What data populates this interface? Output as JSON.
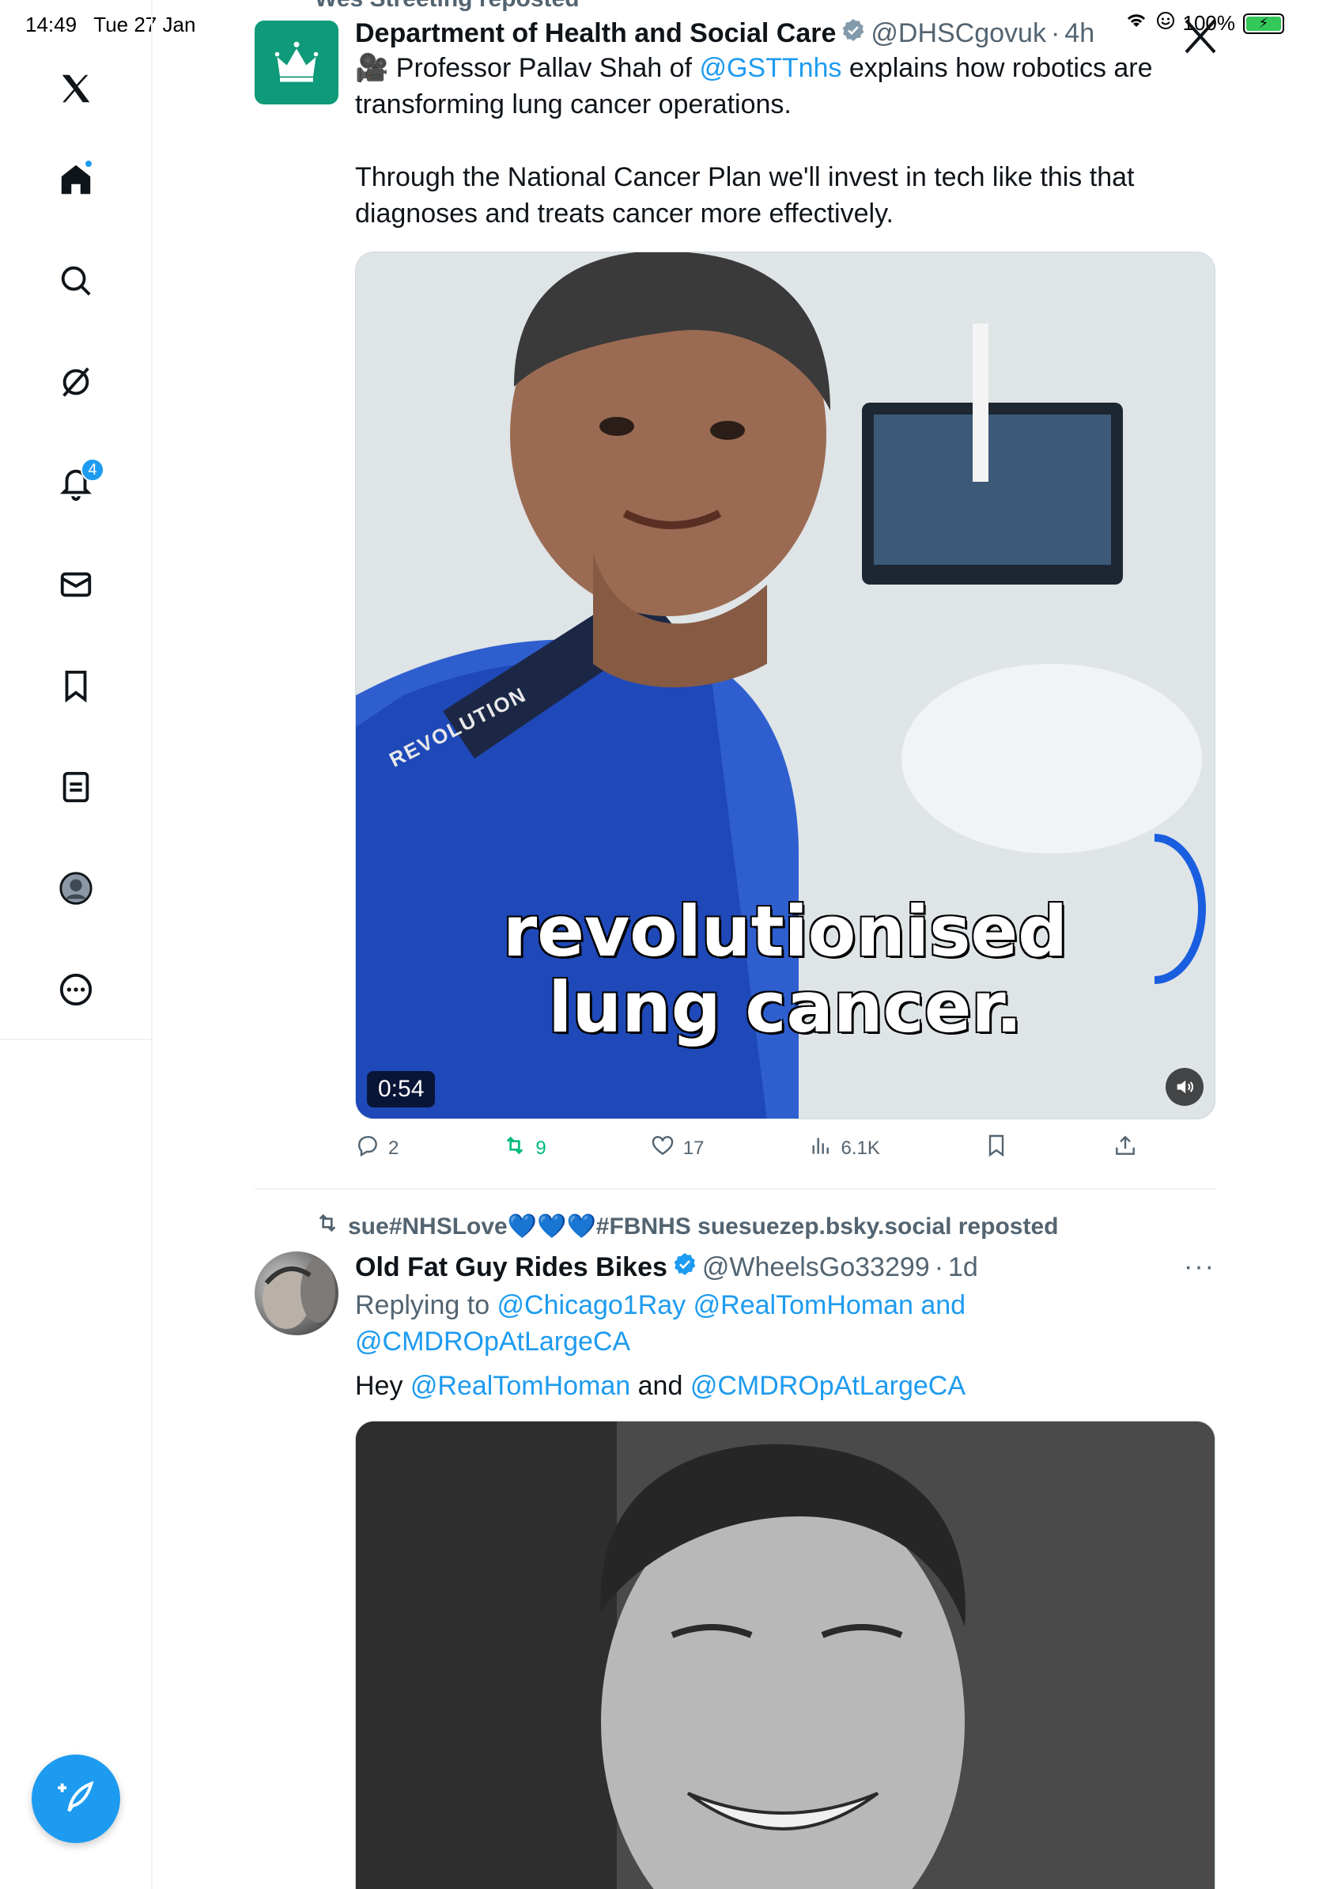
{
  "status": {
    "time": "14:49",
    "date": "Tue 27 Jan",
    "battery": "100%",
    "battery_color": "#34c759"
  },
  "sidebar": {
    "items": [
      {
        "icon": "x-logo-icon"
      },
      {
        "icon": "home-icon",
        "has_dot": true
      },
      {
        "icon": "search-icon"
      },
      {
        "icon": "grok-icon"
      },
      {
        "icon": "bell-icon",
        "badge": "4"
      },
      {
        "icon": "mail-icon"
      },
      {
        "icon": "bookmark-icon"
      },
      {
        "icon": "lists-icon"
      },
      {
        "icon": "profile-icon"
      },
      {
        "icon": "more-circle-icon"
      }
    ],
    "compose_icon": "compose-icon",
    "accent": "#1d9bf0"
  },
  "tweet1": {
    "reposted_by": "Wes Streeting reposted",
    "name": "Department of Health and Social Care",
    "handle": "@DHSCgovuk",
    "time": "4h",
    "text_emoji": "🎥",
    "text_part1": " Professor Pallav Shah of ",
    "text_mention": "@GSTTnhs",
    "text_part2": " explains how robotics are transforming lung cancer operations.",
    "text_para2": "Through the National Cancer Plan we'll invest in tech like this that diagnoses and treats cancer more effectively.",
    "video": {
      "caption_line1": "revolutionised",
      "caption_line2": "lung cancer.",
      "vest_text": "REVOLUTION",
      "duration": "0:54"
    },
    "actions": {
      "replies": "2",
      "reposts": "9",
      "likes": "17",
      "views": "6.1K"
    }
  },
  "tweet2": {
    "reposted_by": "sue#NHSLove💙💙💙#FBNHS suesuezep.bsky.social reposted",
    "name": "Old Fat Guy Rides Bikes",
    "handle": "@WheelsGo33299",
    "time": "1d",
    "replying_prefix": "Replying to ",
    "replying_mention1": "@Chicago1Ray",
    "replying_mention2": "@RealTomHoman",
    "replying_and": " and",
    "replying_mention3": "@CMDROpAtLargeCA",
    "text_prefix": "Hey ",
    "text_mention1": "@RealTomHoman",
    "text_and": " and ",
    "text_mention2": "@CMDROpAtLargeCA",
    "more": "···"
  }
}
